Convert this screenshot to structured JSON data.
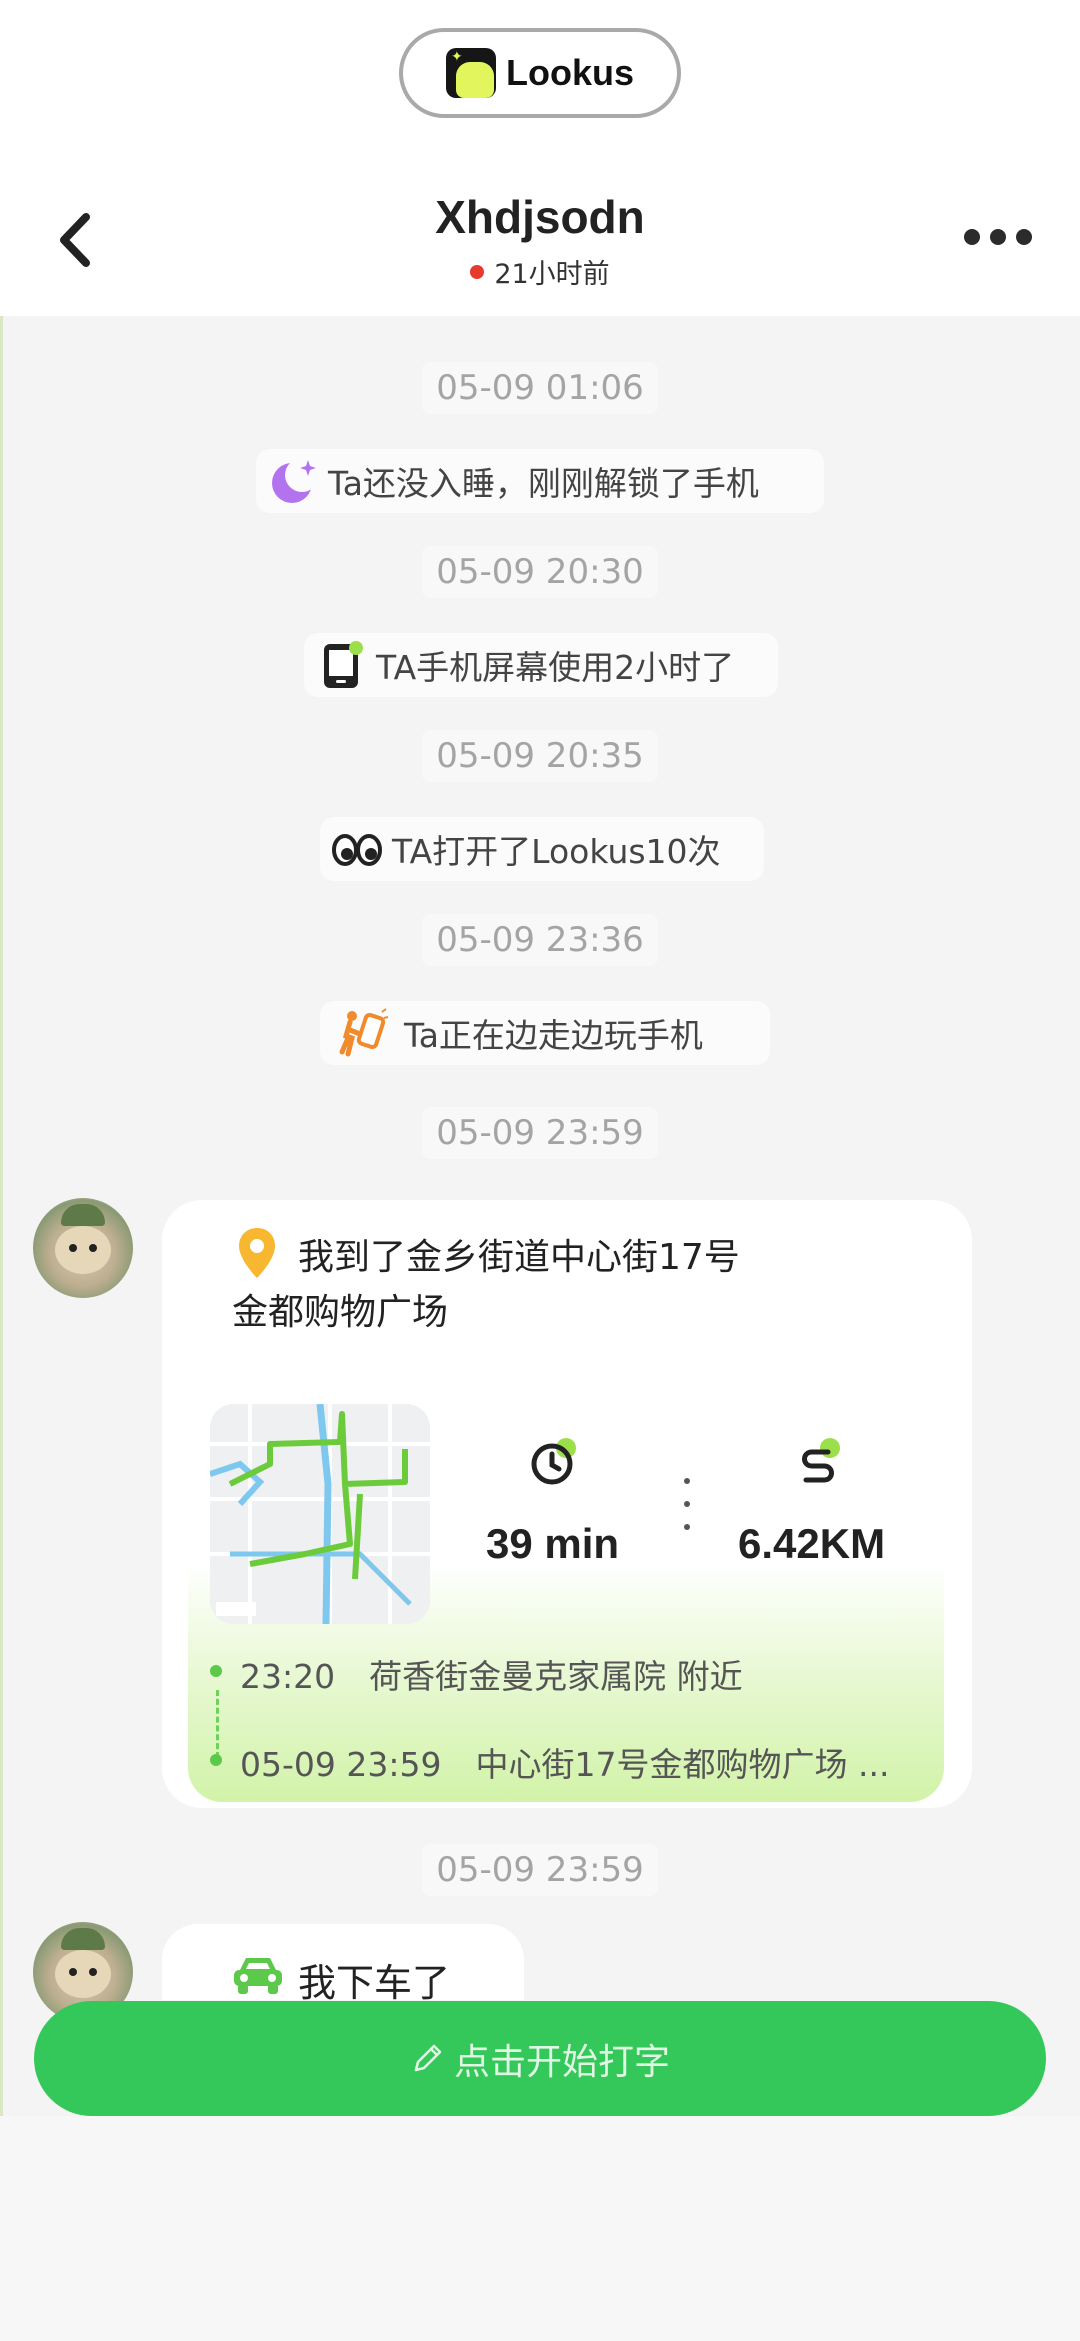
{
  "colors": {
    "accent_green": "#34c759",
    "status_red": "#e8392f",
    "timestamp_gray": "#a4a4a4"
  },
  "brand": {
    "name": "Lookus",
    "icon": "lookus-logo-icon"
  },
  "header": {
    "title": "Xhdjsodn",
    "status": "21小时前",
    "back_icon": "chevron-left-icon",
    "more_icon": "more-dots-icon"
  },
  "timeline": [
    {
      "time": "05-09 01:06",
      "icon": "moon-star-icon",
      "text": "Ta还没入睡，刚刚解锁了手机"
    },
    {
      "time": "05-09 20:30",
      "icon": "phone-screen-icon",
      "text": "TA手机屏幕使用2小时了"
    },
    {
      "time": "05-09 20:35",
      "icon": "eyes-icon",
      "text": "TA打开了Lookus10次"
    },
    {
      "time": "05-09 23:36",
      "icon": "walking-phone-icon",
      "text": "Ta正在边走边玩手机"
    }
  ],
  "location_message": {
    "time": "05-09 23:59",
    "line1": "我到了金乡街道中心街17号",
    "line2": "金都购物广场",
    "duration": "39 min",
    "distance": "6.42KM",
    "start_time": "23:20",
    "start_place": "荷香街金曼克家属院 附近",
    "end_time": "05-09 23:59",
    "end_place": "中心街17号金都购物广场 ..."
  },
  "car_message": {
    "time": "05-09 23:59",
    "icon": "car-icon",
    "text": "我下车了"
  },
  "composer": {
    "label": "点击开始打字",
    "icon": "pencil-icon"
  }
}
